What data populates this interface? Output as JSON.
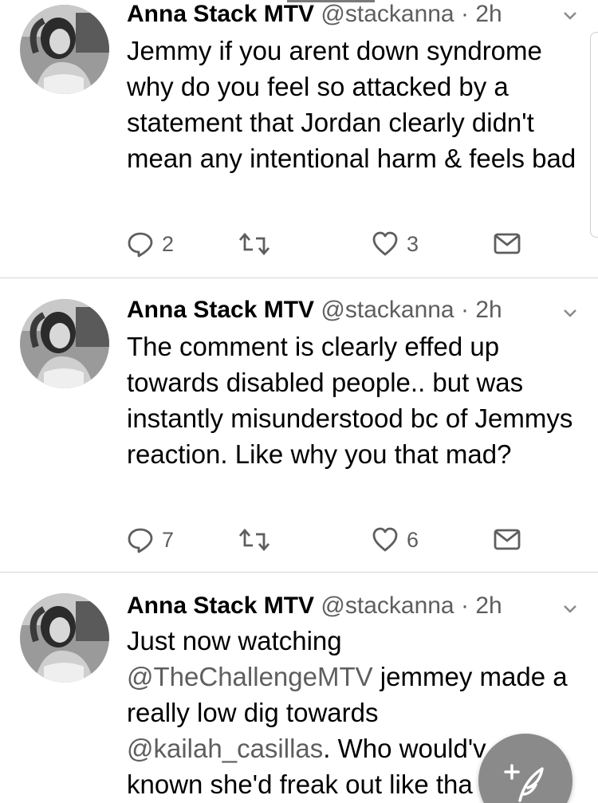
{
  "tweets": [
    {
      "author_name": "Anna Stack MTV",
      "author_handle": "@stackanna",
      "separator": "·",
      "time": "2h",
      "text": "Jemmy if you arent down syndrome why do you feel so attacked by a statement that Jordan clearly didn't mean any intentional harm & feels bad",
      "reply_count": "2",
      "like_count": "3"
    },
    {
      "author_name": "Anna Stack MTV",
      "author_handle": "@stackanna",
      "separator": "·",
      "time": "2h",
      "text": "The comment is clearly effed up towards disabled people.. but was instantly misunderstood bc of Jemmys reaction. Like why you that mad?",
      "reply_count": "7",
      "like_count": "6"
    },
    {
      "author_name": "Anna Stack MTV",
      "author_handle": "@stackanna",
      "separator": "·",
      "time": "2h",
      "text_line1": "Just now watching",
      "mention1": "@TheChallengeMTV",
      "text_after_mention1": " jemmey made a really low dig towards",
      "mention2": "@kailah_casillas",
      "text_after_mention2": ". Who would'v",
      "text_last_line": "known she'd freak out like tha"
    }
  ],
  "icons": {
    "reply": "reply-icon",
    "retweet": "retweet-icon",
    "like": "heart-icon",
    "message": "envelope-icon",
    "menu": "chevron-down-icon",
    "compose": "compose-tweet-icon"
  },
  "colors": {
    "text": "#000000",
    "secondary": "#5e5e5e",
    "divider": "#d6d6d6",
    "fab": "#8a8a8a"
  }
}
